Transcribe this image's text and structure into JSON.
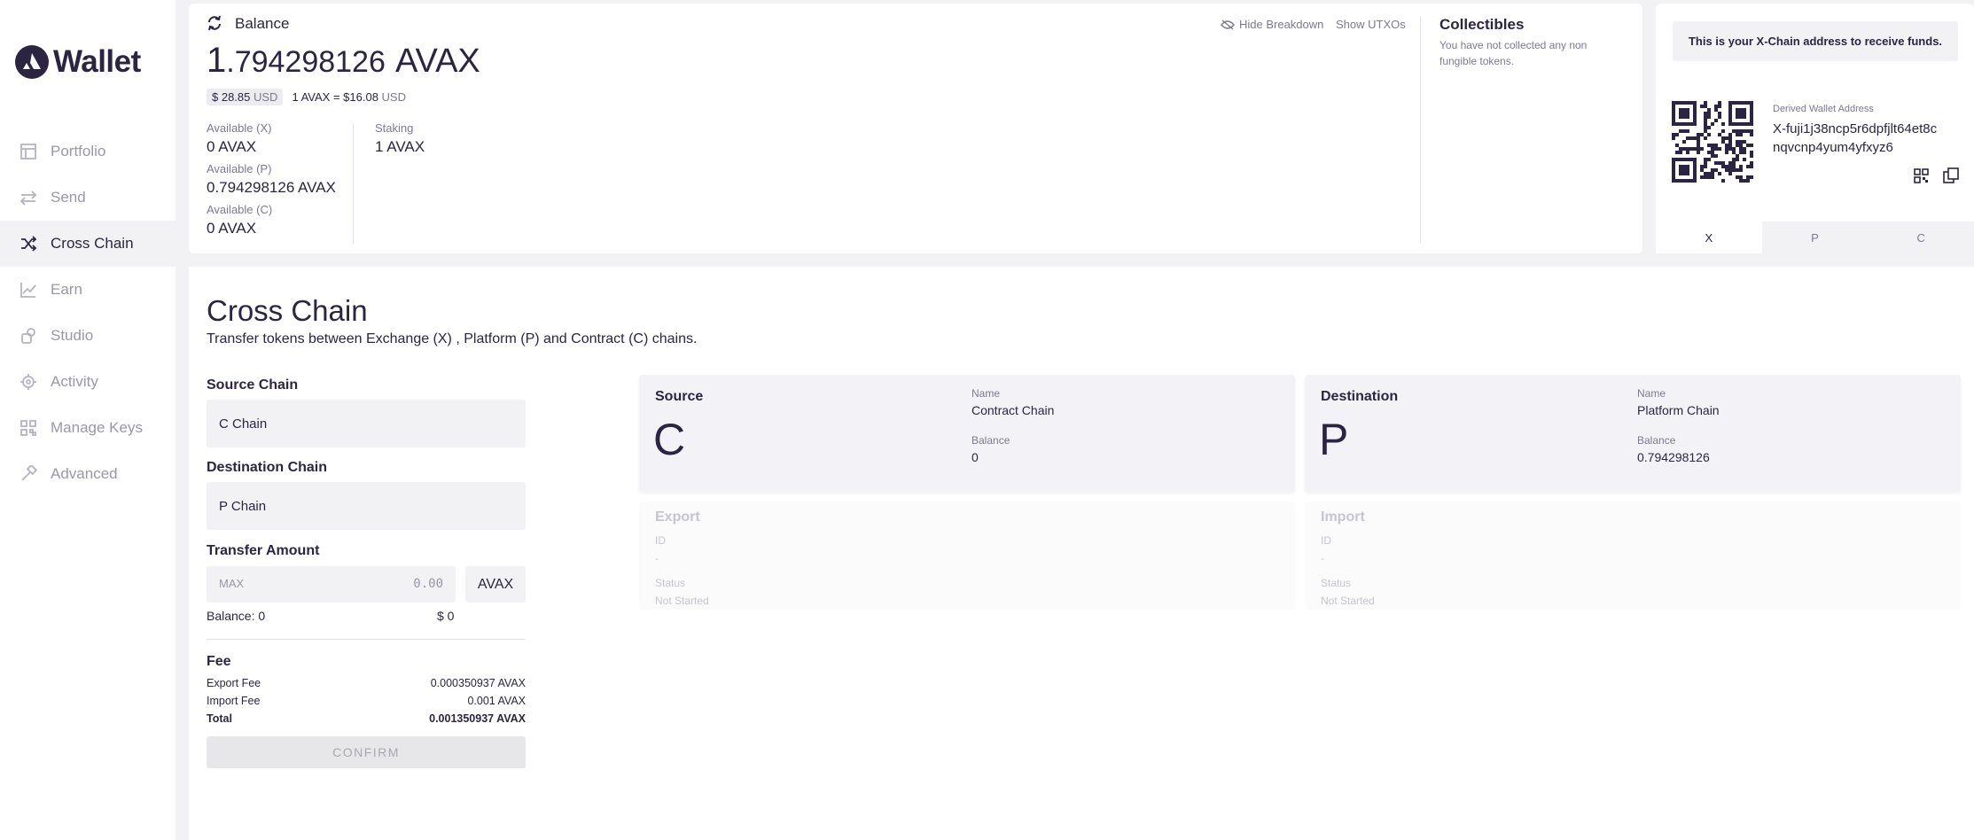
{
  "sidebar": {
    "logo_text": "Wallet",
    "items": [
      {
        "label": "Portfolio",
        "icon": "portfolio-icon"
      },
      {
        "label": "Send",
        "icon": "send-icon"
      },
      {
        "label": "Cross Chain",
        "icon": "cross-chain-icon",
        "active": true
      },
      {
        "label": "Earn",
        "icon": "earn-icon"
      },
      {
        "label": "Studio",
        "icon": "studio-icon"
      },
      {
        "label": "Activity",
        "icon": "activity-icon"
      },
      {
        "label": "Manage Keys",
        "icon": "manage-keys-icon"
      },
      {
        "label": "Advanced",
        "icon": "advanced-icon"
      }
    ]
  },
  "balance": {
    "title": "Balance",
    "amount_int": "1",
    "amount_dec": ".794298126",
    "unit": "AVAX",
    "usd_value": "$ 28.85",
    "usd_unit": "USD",
    "rate_prefix": "1 AVAX = ",
    "rate_value": "$16.08",
    "rate_unit": "USD",
    "hide_breakdown": "Hide Breakdown",
    "show_utxos": "Show UTXOs",
    "available_x_label": "Available (X)",
    "available_x_value": "0 AVAX",
    "available_p_label": "Available (P)",
    "available_p_value": "0.794298126 AVAX",
    "available_c_label": "Available (C)",
    "available_c_value": "0 AVAX",
    "staking_label": "Staking",
    "staking_value": "1 AVAX"
  },
  "collectibles": {
    "title": "Collectibles",
    "text": "You have not collected any non fungible tokens."
  },
  "address": {
    "banner": "This is your X-Chain address to receive funds.",
    "derived_label": "Derived Wallet Address",
    "address_line1": "X-fuji1j38ncp5r6dpfjlt64et8c",
    "address_line2": "nqvcnp4yum4yfxyz6",
    "tabs": [
      "X",
      "P",
      "C"
    ]
  },
  "cross_chain": {
    "title": "Cross Chain",
    "subtitle": "Transfer tokens between Exchange (X) , Platform (P) and Contract (C) chains.",
    "source_chain_label": "Source Chain",
    "source_chain_value": "C Chain",
    "destination_chain_label": "Destination Chain",
    "destination_chain_value": "P Chain",
    "transfer_amount_label": "Transfer Amount",
    "max_label": "MAX",
    "amount_placeholder": "0.00",
    "amount_unit": "AVAX",
    "balance_text": "Balance: 0",
    "balance_usd": "$ 0",
    "fee_title": "Fee",
    "export_fee_label": "Export Fee",
    "export_fee_value": "0.000350937 AVAX",
    "import_fee_label": "Import Fee",
    "import_fee_value": "0.001 AVAX",
    "total_label": "Total",
    "total_value": "0.001350937 AVAX",
    "confirm_label": "CONFIRM"
  },
  "source_card": {
    "title": "Source",
    "letter": "C",
    "name_label": "Name",
    "name_value": "Contract Chain",
    "balance_label": "Balance",
    "balance_value": "0"
  },
  "destination_card": {
    "title": "Destination",
    "letter": "P",
    "name_label": "Name",
    "name_value": "Platform Chain",
    "balance_label": "Balance",
    "balance_value": "0.794298126"
  },
  "export_card": {
    "title": "Export",
    "id_label": "ID",
    "id_value": "-",
    "status_label": "Status",
    "status_value": "Not Started"
  },
  "import_card": {
    "title": "Import",
    "id_label": "ID",
    "id_value": "-",
    "status_label": "Status",
    "status_value": "Not Started"
  }
}
